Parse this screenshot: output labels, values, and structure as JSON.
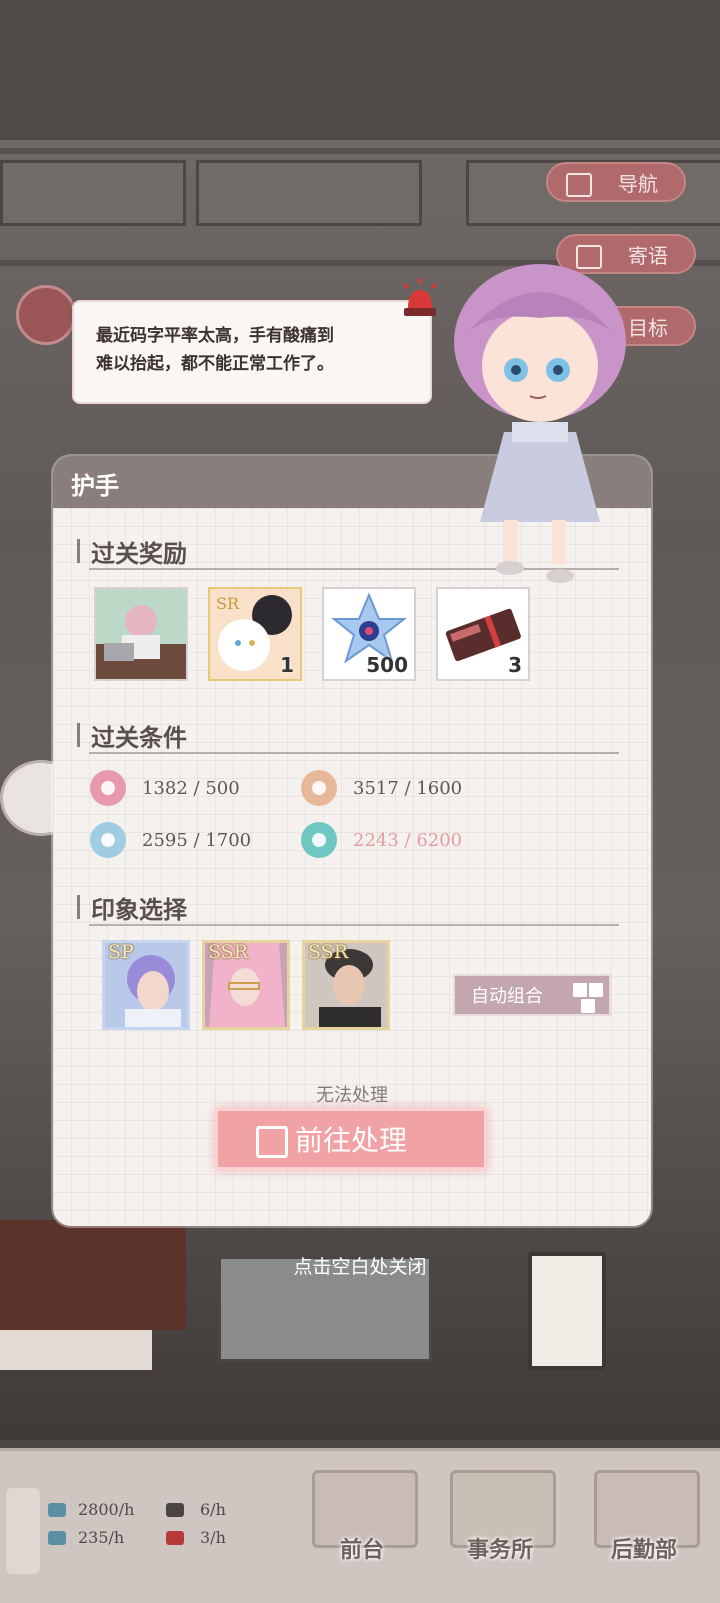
{
  "nav_pills": {
    "navigate": "导航",
    "message": "寄语",
    "goal": "目标"
  },
  "speech": {
    "text_line1": "最近码字平率太高，手有酸痛到",
    "text_line2": "难以抬起，都不能正常工作了。"
  },
  "panel": {
    "title": "护手",
    "reward_section": "过关奖励",
    "rewards": [
      {
        "icon": "cg-image",
        "count": ""
      },
      {
        "icon": "sr-cat-card",
        "count": "1"
      },
      {
        "icon": "crystal-flower",
        "count": "500"
      },
      {
        "icon": "ticket",
        "count": "3"
      }
    ],
    "condition_section": "过关条件",
    "conditions": [
      {
        "icon": "writing-icon",
        "current": "1382",
        "sep": " / ",
        "target": "500",
        "color": "#e89aad"
      },
      {
        "icon": "people-icon",
        "current": "3517",
        "sep": " / ",
        "target": "1600",
        "color": "#e8b89b"
      },
      {
        "icon": "graduate-icon",
        "current": "2595",
        "sep": " / ",
        "target": "1700",
        "color": "#9fcbe3"
      },
      {
        "icon": "flower-icon",
        "current": "2243",
        "sep": " / ",
        "target": "6200",
        "color": "#6fc7c2"
      }
    ],
    "unmet_color": "#e89ba0",
    "impression_section": "印象选择",
    "cards": [
      {
        "rank": "SP"
      },
      {
        "rank": "SSR"
      },
      {
        "rank": "SSR"
      }
    ],
    "auto_button": "自动组合",
    "disabled_text": "无法处理",
    "go_button": "前往处理"
  },
  "close_hint": "点击空白处关闭",
  "bottom": {
    "stats": [
      {
        "icon": "money-icon",
        "value": "2800/h"
      },
      {
        "icon": "staff-icon",
        "value": "6/h"
      },
      {
        "icon": "book-icon",
        "value": "235/h"
      },
      {
        "icon": "gift-icon",
        "value": "3/h"
      }
    ],
    "nav": [
      {
        "label": "前台"
      },
      {
        "label": "事务所"
      },
      {
        "label": "后勤部"
      }
    ]
  }
}
